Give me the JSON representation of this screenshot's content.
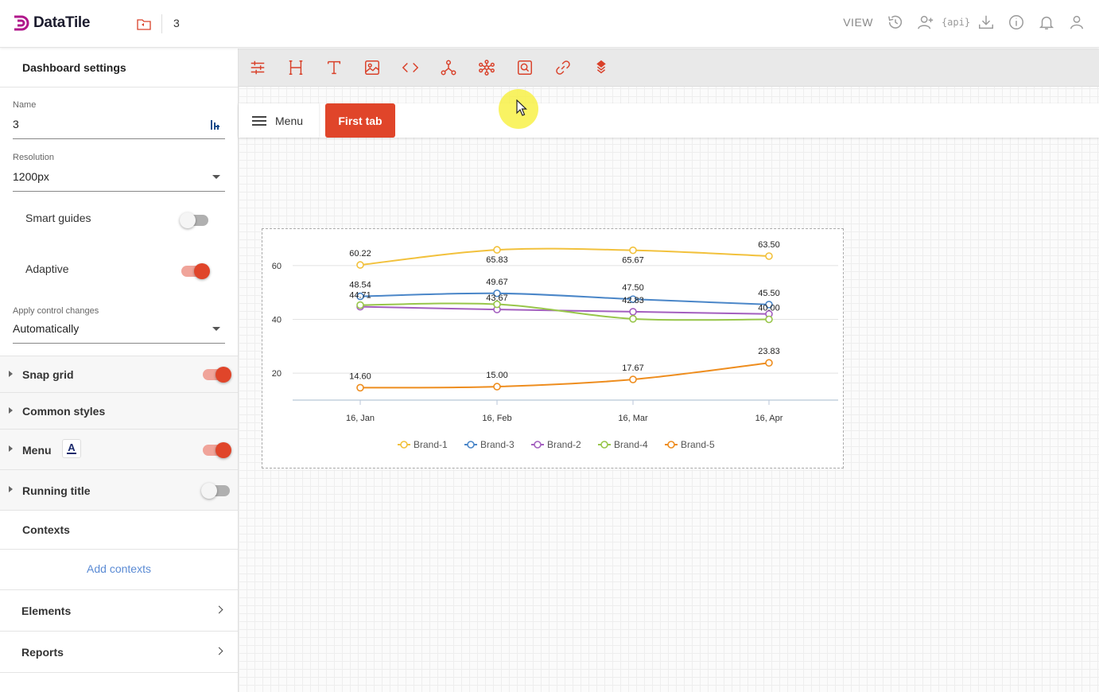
{
  "app": {
    "brand": "DataTile",
    "dashboard_name": "3",
    "mode_label": "VIEW"
  },
  "sidebar": {
    "title": "Dashboard settings",
    "name_label": "Name",
    "name_value": "3",
    "resolution_label": "Resolution",
    "resolution_value": "1200px",
    "smart_guides_label": "Smart guides",
    "smart_guides_on": false,
    "adaptive_label": "Adaptive",
    "adaptive_on": true,
    "apply_label": "Apply control changes",
    "apply_value": "Automatically",
    "sections": {
      "snap_grid": "Snap grid",
      "common_styles": "Common styles",
      "menu": "Menu",
      "menu_font_glyph": "A",
      "running_title": "Running title"
    },
    "contexts_label": "Contexts",
    "add_contexts": "Add contexts",
    "elements_label": "Elements",
    "reports_label": "Reports"
  },
  "canvas": {
    "menu_label": "Menu",
    "tab_label": "First tab",
    "accent_color": "#e0452a"
  },
  "toolbar_icons": [
    "filters-icon",
    "heading-icon",
    "text-icon",
    "image-icon",
    "code-icon",
    "network-icon",
    "cluster-icon",
    "search-box-icon",
    "link-icon",
    "layers-icon"
  ],
  "header_icons": [
    "history-icon",
    "add-user-icon",
    "api-icon",
    "download-icon",
    "info-icon",
    "bell-icon",
    "user-icon"
  ],
  "chart_data": {
    "type": "line",
    "categories": [
      "16, Jan",
      "16, Feb",
      "16, Mar",
      "16, Apr"
    ],
    "ylim": [
      10,
      70
    ],
    "yticks": [
      20,
      40,
      60
    ],
    "grid": true,
    "legend": "bottom",
    "series": [
      {
        "name": "Brand-1",
        "color": "#f2c13c",
        "values": [
          60.22,
          65.83,
          65.67,
          63.5
        ],
        "labels": [
          "60.22",
          "65.83",
          "65.67",
          "63.50"
        ]
      },
      {
        "name": "Brand-3",
        "color": "#4a86c8",
        "values": [
          48.54,
          49.67,
          47.5,
          45.5
        ],
        "labels": [
          "48.54",
          "49.67",
          "47.50",
          "45.50"
        ]
      },
      {
        "name": "Brand-2",
        "color": "#a35fbf",
        "values": [
          44.71,
          43.67,
          42.83,
          42.0
        ],
        "labels": [
          "44.71",
          "43.67",
          "42.83",
          ""
        ]
      },
      {
        "name": "Brand-4",
        "color": "#98c64a",
        "values": [
          45.3,
          45.6,
          40.2,
          40.0
        ],
        "labels": [
          "",
          "",
          "",
          "40.00"
        ]
      },
      {
        "name": "Brand-5",
        "color": "#ee8d1e",
        "values": [
          14.6,
          15.0,
          17.67,
          23.83
        ],
        "labels": [
          "14.60",
          "15.00",
          "17.67",
          "23.83"
        ]
      }
    ]
  }
}
